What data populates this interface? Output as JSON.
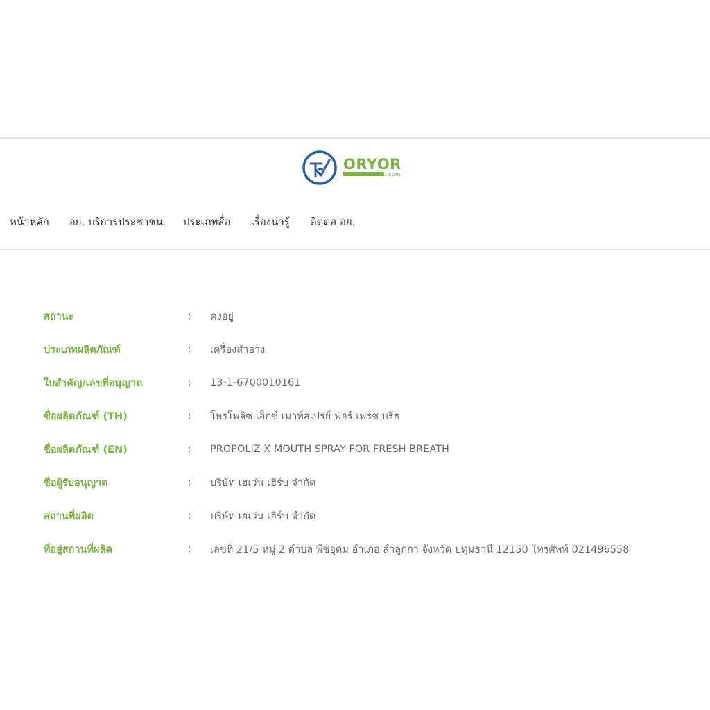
{
  "brand": {
    "logo_main": "ORYOR",
    "logo_sub": ".com",
    "colors": {
      "logo_blue": "#2a5ea8",
      "logo_green": "#7ab33f",
      "label_green": "#7ab33f"
    }
  },
  "nav": {
    "items": [
      {
        "label": "หน้าหลัก"
      },
      {
        "label": "อย. บริการประชาชน"
      },
      {
        "label": "ประเภทสื่อ"
      },
      {
        "label": "เรื่องน่ารู้"
      },
      {
        "label": "ติดต่อ อย."
      }
    ]
  },
  "details": {
    "separator": ":",
    "rows": [
      {
        "label": "สถานะ",
        "value": "คงอยู่"
      },
      {
        "label": "ประเภทผลิตภัณฑ์",
        "value": "เครื่องสำอาง"
      },
      {
        "label": "ใบสำคัญ/เลขที่อนุญาต",
        "value": "13-1-6700010161"
      },
      {
        "label": "ชื่อผลิตภัณฑ์ (TH)",
        "value": "โพรโพลิซ เอ็กซ์ เมาท์สเปรย์ ฟอร์ เฟรช บรีธ"
      },
      {
        "label": "ชื่อผลิตภัณฑ์ (EN)",
        "value": "PROPOLIZ X MOUTH SPRAY FOR FRESH BREATH"
      },
      {
        "label": "ชื่อผู้รับอนุญาต",
        "value": "บริษัท เฮเว่น เฮิร์บ จำกัด"
      },
      {
        "label": "สถานที่ผลิต",
        "value": "บริษัท เฮเว่น เฮิร์บ จำกัด"
      },
      {
        "label": "ที่อยู่สถานที่ผลิต",
        "value": "เลขที่ 21/5 หมู่ 2 ตำบล พืชอุดม อำเภอ ลำลูกกา จังหวัด ปทุมธานี 12150 โทรศัพท์ 021496558"
      }
    ]
  }
}
